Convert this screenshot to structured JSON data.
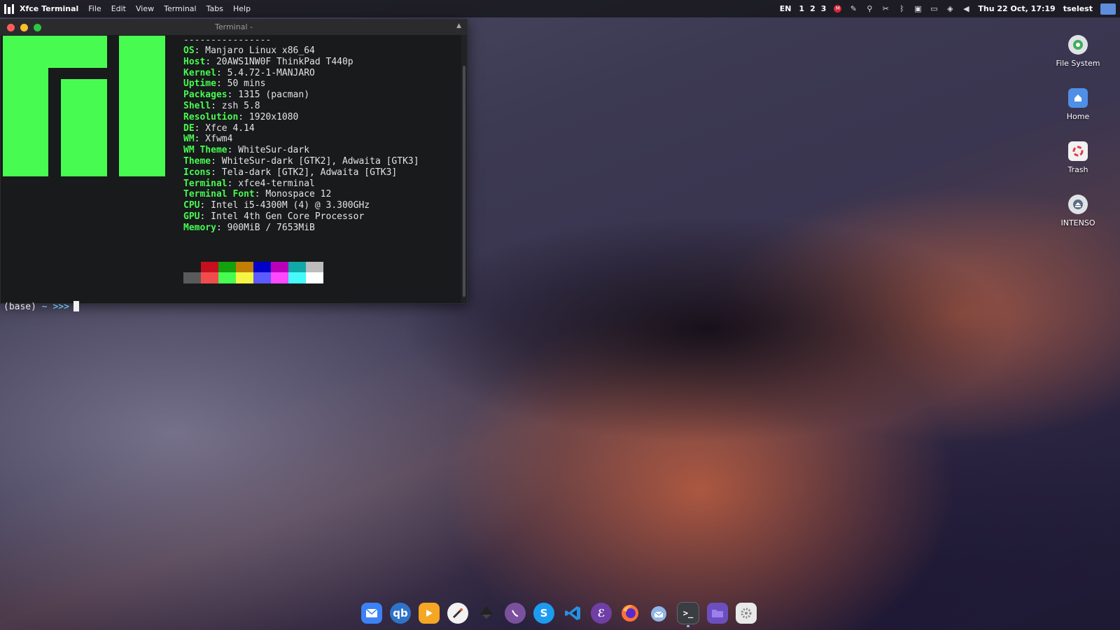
{
  "top_panel": {
    "app_name": "Xfce Terminal",
    "menu": [
      "File",
      "Edit",
      "View",
      "Terminal",
      "Tabs",
      "Help"
    ],
    "tray": {
      "language": "EN",
      "workspaces": [
        "1",
        "2",
        "3"
      ],
      "clock": "Thu 22 Oct, 17:19",
      "user": "tselest"
    }
  },
  "terminal": {
    "title": "Terminal -",
    "separator": "----------------",
    "info": [
      {
        "key": "OS",
        "value": ": Manjaro Linux x86_64"
      },
      {
        "key": "Host",
        "value": ": 20AWS1NW0F ThinkPad T440p"
      },
      {
        "key": "Kernel",
        "value": ": 5.4.72-1-MANJARO"
      },
      {
        "key": "Uptime",
        "value": ": 50 mins"
      },
      {
        "key": "Packages",
        "value": ": 1315 (pacman)"
      },
      {
        "key": "Shell",
        "value": ": zsh 5.8"
      },
      {
        "key": "Resolution",
        "value": ": 1920x1080"
      },
      {
        "key": "DE",
        "value": ": Xfce 4.14"
      },
      {
        "key": "WM",
        "value": ": Xfwm4"
      },
      {
        "key": "WM Theme",
        "value": ": WhiteSur-dark"
      },
      {
        "key": "Theme",
        "value": ": WhiteSur-dark [GTK2], Adwaita [GTK3]"
      },
      {
        "key": "Icons",
        "value": ": Tela-dark [GTK2], Adwaita [GTK3]"
      },
      {
        "key": "Terminal",
        "value": ": xfce4-terminal"
      },
      {
        "key": "Terminal Font",
        "value": ": Monospace 12"
      },
      {
        "key": "CPU",
        "value": ": Intel i5-4300M (4) @ 3.300GHz"
      },
      {
        "key": "GPU",
        "value": ": Intel 4th Gen Core Processor"
      },
      {
        "key": "Memory",
        "value": ": 900MiB / 7653MiB"
      }
    ],
    "palette_top": [
      "#1a1a1a",
      "#c50f1f",
      "#13a10e",
      "#c17e00",
      "#0000c8",
      "#b800b8",
      "#11a8a8",
      "#bcbcbc"
    ],
    "palette_bottom": [
      "#5a5a5a",
      "#f14c4c",
      "#47fb51",
      "#f5f543",
      "#5b5bff",
      "#ff49ff",
      "#46fafa",
      "#ffffff"
    ],
    "prompt": {
      "env": "(base)",
      "dir": "~",
      "arrow": ">>>"
    },
    "logo_color": "#47fb51"
  },
  "desktop_icons": [
    {
      "label": "File System",
      "icon": "drive-icon"
    },
    {
      "label": "Home",
      "icon": "home-folder-icon"
    },
    {
      "label": "Trash",
      "icon": "trash-icon"
    },
    {
      "label": "INTENSO",
      "icon": "usb-drive-icon"
    }
  ],
  "dock": [
    "mail-icon",
    "qbittorrent-icon",
    "media-player-icon",
    "drawing-icon",
    "inkscape-icon",
    "viber-icon",
    "skype-icon",
    "vscode-icon",
    "emacs-icon",
    "firefox-icon",
    "thunderbird-icon",
    "terminal-icon",
    "file-manager-icon",
    "settings-icon"
  ]
}
